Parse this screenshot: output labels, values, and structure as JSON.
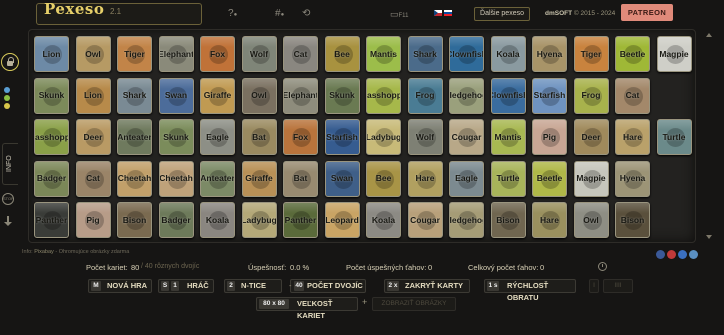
{
  "header": {
    "logo": "Pexeso",
    "version": "2.1",
    "next_button": "Ďalšie pexeso",
    "copyright_brand": "dmSOFT",
    "copyright_years": "© 2015 - 2024",
    "patreon": "PATREON",
    "fullscreen_label": "F11",
    "icons": [
      "help-icon",
      "players-icon",
      "history-icon",
      "fullscreen-icon"
    ]
  },
  "rail": {
    "info_label": "INFO",
    "stop_label": "STOP",
    "dots": [
      "#5a9fd4",
      "#8cc043",
      "#d8c64a"
    ]
  },
  "board": {
    "rows": [
      [
        {
          "name": "Lion",
          "color": "#6d8aa6"
        },
        {
          "name": "Owl",
          "color": "#b69a64"
        },
        {
          "name": "Tiger",
          "color": "#c28448"
        },
        {
          "name": "Elephant",
          "color": "#8a8a7a"
        },
        {
          "name": "Fox",
          "color": "#c07238"
        },
        {
          "name": "Wolf",
          "color": "#7f8578"
        },
        {
          "name": "Cat",
          "color": "#8a8780"
        },
        {
          "name": "Bee",
          "color": "#a8923f"
        },
        {
          "name": "Mantis",
          "color": "#9cbd4a"
        },
        {
          "name": "Shark",
          "color": "#4b6b8a"
        },
        {
          "name": "Clownfish",
          "color": "#2f6b9a"
        },
        {
          "name": "Koala",
          "color": "#8a9aa0"
        },
        {
          "name": "Hyena",
          "color": "#a89468"
        },
        {
          "name": "Tiger",
          "color": "#c9833e"
        },
        {
          "name": "Beetle",
          "color": "#9fb836"
        },
        {
          "name": "Magpie",
          "color": "#cfcfc8"
        }
      ],
      [
        {
          "name": "Skunk",
          "color": "#7c8a5a"
        },
        {
          "name": "Lion",
          "color": "#b78a4a"
        },
        {
          "name": "Shark",
          "color": "#7a8a94"
        },
        {
          "name": "Swan",
          "color": "#4c6c9a"
        },
        {
          "name": "Giraffe",
          "color": "#c09a52"
        },
        {
          "name": "Owl",
          "color": "#7a7060"
        },
        {
          "name": "Elephant",
          "color": "#8e8c7c"
        },
        {
          "name": "Skunk",
          "color": "#6a7a52"
        },
        {
          "name": "Grasshopper",
          "color": "#a6b84a"
        },
        {
          "name": "Frog",
          "color": "#4a7c94"
        },
        {
          "name": "Hedgehog",
          "color": "#9aa07c"
        },
        {
          "name": "Clownfish",
          "color": "#3a6c9e"
        },
        {
          "name": "Starfish",
          "color": "#6f93c0"
        },
        {
          "name": "Frog",
          "color": "#a8b24c"
        },
        {
          "name": "Cat",
          "color": "#a3886a"
        }
      ],
      [
        {
          "name": "Grasshopper",
          "color": "#8aa048"
        },
        {
          "name": "Deer",
          "color": "#b99a64"
        },
        {
          "name": "Anteater",
          "color": "#6f7a5e"
        },
        {
          "name": "Skunk",
          "color": "#7b8c5b"
        },
        {
          "name": "Eagle",
          "color": "#8d8f86"
        },
        {
          "name": "Bat",
          "color": "#9a8a60"
        },
        {
          "name": "Fox",
          "color": "#b9743c"
        },
        {
          "name": "Starfish",
          "color": "#365c90"
        },
        {
          "name": "Ladybug",
          "color": "#c8ba78"
        },
        {
          "name": "Wolf",
          "color": "#7e8074"
        },
        {
          "name": "Cougar",
          "color": "#b8a888"
        },
        {
          "name": "Mantis",
          "color": "#a8b852"
        },
        {
          "name": "Pig",
          "color": "#c8a694"
        },
        {
          "name": "Deer",
          "color": "#a08a5c"
        },
        {
          "name": "Hare",
          "color": "#b9a16a"
        },
        {
          "name": "Turtle",
          "color": "#6b8a8a"
        }
      ],
      [
        {
          "name": "Badger",
          "color": "#7b8758"
        },
        {
          "name": "Cat",
          "color": "#9a8468"
        },
        {
          "name": "Cheetah",
          "color": "#c2a06a"
        },
        {
          "name": "Cheetah",
          "color": "#bfa27a"
        },
        {
          "name": "Anteater",
          "color": "#7c8a66"
        },
        {
          "name": "Giraffe",
          "color": "#b89056"
        },
        {
          "name": "Bat",
          "color": "#988a70"
        },
        {
          "name": "Swan",
          "color": "#3f5f88"
        },
        {
          "name": "Bee",
          "color": "#a89446"
        },
        {
          "name": "Hare",
          "color": "#b1a060"
        },
        {
          "name": "Eagle",
          "color": "#7c8a90"
        },
        {
          "name": "Turtle",
          "color": "#a8b45a"
        },
        {
          "name": "Beetle",
          "color": "#b0b848"
        },
        {
          "name": "Magpie",
          "color": "#c6c6bc"
        },
        {
          "name": "Hyena",
          "color": "#9c9476"
        }
      ],
      [
        {
          "name": "Panther",
          "color": "#3a3c38"
        },
        {
          "name": "Pig",
          "color": "#b79c88"
        },
        {
          "name": "Bison",
          "color": "#7a6a50"
        },
        {
          "name": "Badger",
          "color": "#6d7a5a"
        },
        {
          "name": "Koala",
          "color": "#8a8680"
        },
        {
          "name": "Ladybug",
          "color": "#b4a878"
        },
        {
          "name": "Panther",
          "color": "#5a6a3a"
        },
        {
          "name": "Leopard",
          "color": "#c9a464"
        },
        {
          "name": "Koala",
          "color": "#8c8a84"
        },
        {
          "name": "Cougar",
          "color": "#b8a07a"
        },
        {
          "name": "Hedgehog",
          "color": "#a59c76"
        },
        {
          "name": "Bison",
          "color": "#706650"
        },
        {
          "name": "Hare",
          "color": "#9a905e"
        },
        {
          "name": "Owl",
          "color": "#8e8e84"
        },
        {
          "name": "Bison",
          "color": "#5a503c"
        }
      ]
    ]
  },
  "source": {
    "label": "Info:",
    "link": "Pixabay",
    "text": "- Ohromujúce obrázky zdarma"
  },
  "social": [
    "#3b5998",
    "#c03a3a",
    "#3a6fc0",
    "#5a8fc0"
  ],
  "stats": {
    "cards_label": "Počet kariet:",
    "cards_value": "80",
    "cards_extra": "/ 40 rôznych dvojíc",
    "success_label": "Úspešnosť:",
    "success_value": "0.0 %",
    "success_moves_label": "Počet úspešných ťahov:",
    "success_moves_value": "0",
    "total_moves_label": "Celkový počet ťahov:",
    "total_moves_value": "0"
  },
  "controls": {
    "new_game_key": "M",
    "new_game": "NOVÁ HRA",
    "player_key": "S",
    "player_count": "1",
    "player": "HRÁČ",
    "ntice_key": "2",
    "ntice": "N-TICE",
    "pairs_key": "40",
    "pairs": "POČET DVOJÍC",
    "close_key": "2 x",
    "close": "ZAKRYŤ KARTY",
    "speed_key": "1 s",
    "speed": "RÝCHLOSŤ OBRATU",
    "disabled_a": "I",
    "disabled_b": "IIII",
    "size_key": "80 x 80",
    "size": "VEĽKOSŤ KARIET",
    "disabled_c": "ZOBRAZIŤ OBRÁZKY"
  }
}
